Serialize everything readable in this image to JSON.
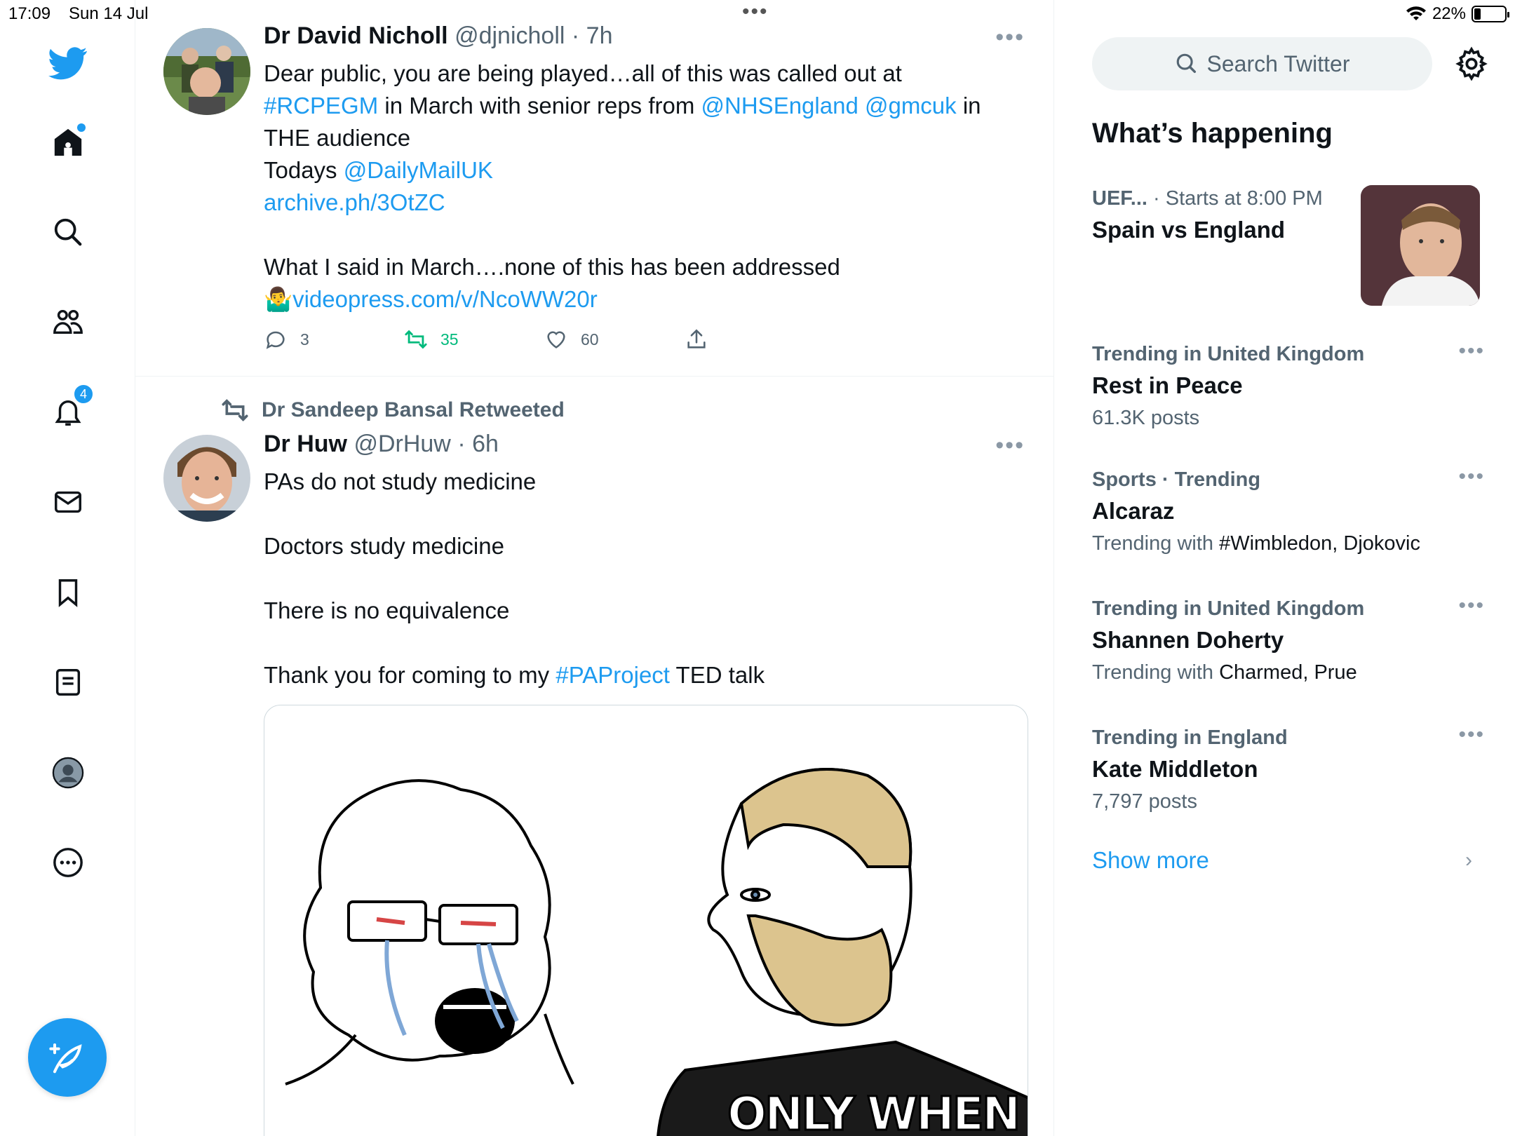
{
  "status_bar": {
    "time": "17:09",
    "date": "Sun 14 Jul",
    "battery": "22%",
    "battery_level": 0.22,
    "dots": "•••"
  },
  "nav": {
    "notifications_badge": "4",
    "colors": {
      "accent": "#1d9bf0"
    }
  },
  "tweets": [
    {
      "name": "Dr David Nicholl",
      "handle": "@djnicholl",
      "time": "7h",
      "separator": "·",
      "more": "•••",
      "text_parts": [
        "Dear public, you are being played…all of this was called out at\n",
        "#RCPEGM",
        " in March with senior reps from ",
        "@NHSEngland",
        " ",
        "@gmcuk",
        " in\nTHE audience\nTodays ",
        "@DailyMailUK",
        "\n",
        "archive.ph/3OtZC",
        "\n\nWhat I said in March….none of this has been addressed\n",
        "🤷‍♂️",
        "videopress.com/v/NcoWW20r"
      ],
      "replies": "3",
      "retweets": "35",
      "likes": "60"
    },
    {
      "retweeted_by": "Dr Sandeep Bansal Retweeted",
      "name": "Dr Huw",
      "handle": "@DrHuw",
      "time": "6h",
      "separator": "·",
      "more": "•••",
      "text_parts": [
        "PAs do not study medicine\n\nDoctors study medicine\n\nThere is no equivalence\n\nThank you for coming to my ",
        "#PAProject",
        " TED talk"
      ],
      "media_caption": "ONLY WHEN"
    }
  ],
  "right": {
    "search_placeholder": "Search Twitter",
    "section_title": "What’s happening",
    "event": {
      "category": "UEF...",
      "meta": "· Starts at 8:00 PM",
      "name": "Spain vs England"
    },
    "trends": [
      {
        "meta": "Trending in United Kingdom",
        "name": "Rest in Peace",
        "sub": "61.3K posts",
        "sub_dark": ""
      },
      {
        "meta": "Sports · Trending",
        "name": "Alcaraz",
        "sub": "Trending with ",
        "sub_dark": "#Wimbledon, Djokovic"
      },
      {
        "meta": "Trending in United Kingdom",
        "name": "Shannen Doherty",
        "sub": "Trending with ",
        "sub_dark": "Charmed, Prue"
      },
      {
        "meta": "Trending in England",
        "name": "Kate Middleton",
        "sub": "7,797 posts",
        "sub_dark": ""
      }
    ],
    "trend_more": "•••",
    "show_more": "Show more",
    "show_more_chevron": "›"
  }
}
